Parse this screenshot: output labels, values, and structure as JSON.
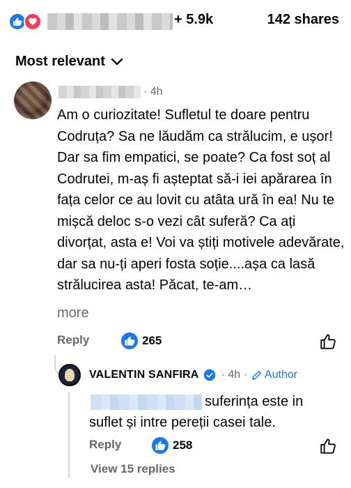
{
  "reactions": {
    "count_label": "+ 5.9k",
    "shares_label": "142 shares",
    "like_color": "#1877f2",
    "love_color": "#f33e58"
  },
  "sort": {
    "label": "Most relevant",
    "icon": "chevron-down-icon"
  },
  "comment": {
    "time": "· 4h",
    "text": "Am o curiozitate! Sufletul te doare pentru Codruța? Sa ne lăudăm ca strălucim,  e ușor! Dar sa fim empatici, se poate? Ca fost soț al Codrutei, m-aș fi așteptat să-i iei apărarea în fața celor ce au lovit cu atâta ură în ea! Nu te mișcă deloc s-o vezi cât suferă? Ca ați divorțat, asta e! Voi va știți motivele adevărate, dar sa nu-ți aperi fosta soție....așa  ca lasă strălucirea asta! Păcat, te-am…",
    "more_label": "more",
    "reply_label": "Reply",
    "like_count": "265"
  },
  "reply": {
    "author": "VALENTIN SANFIRA",
    "time": "· 4h ·",
    "author_tag": "Author",
    "text": "suferința este in suflet și intre pereții casei tale.",
    "reply_label": "Reply",
    "like_count": "258",
    "view_replies_label": "View 15 replies"
  }
}
